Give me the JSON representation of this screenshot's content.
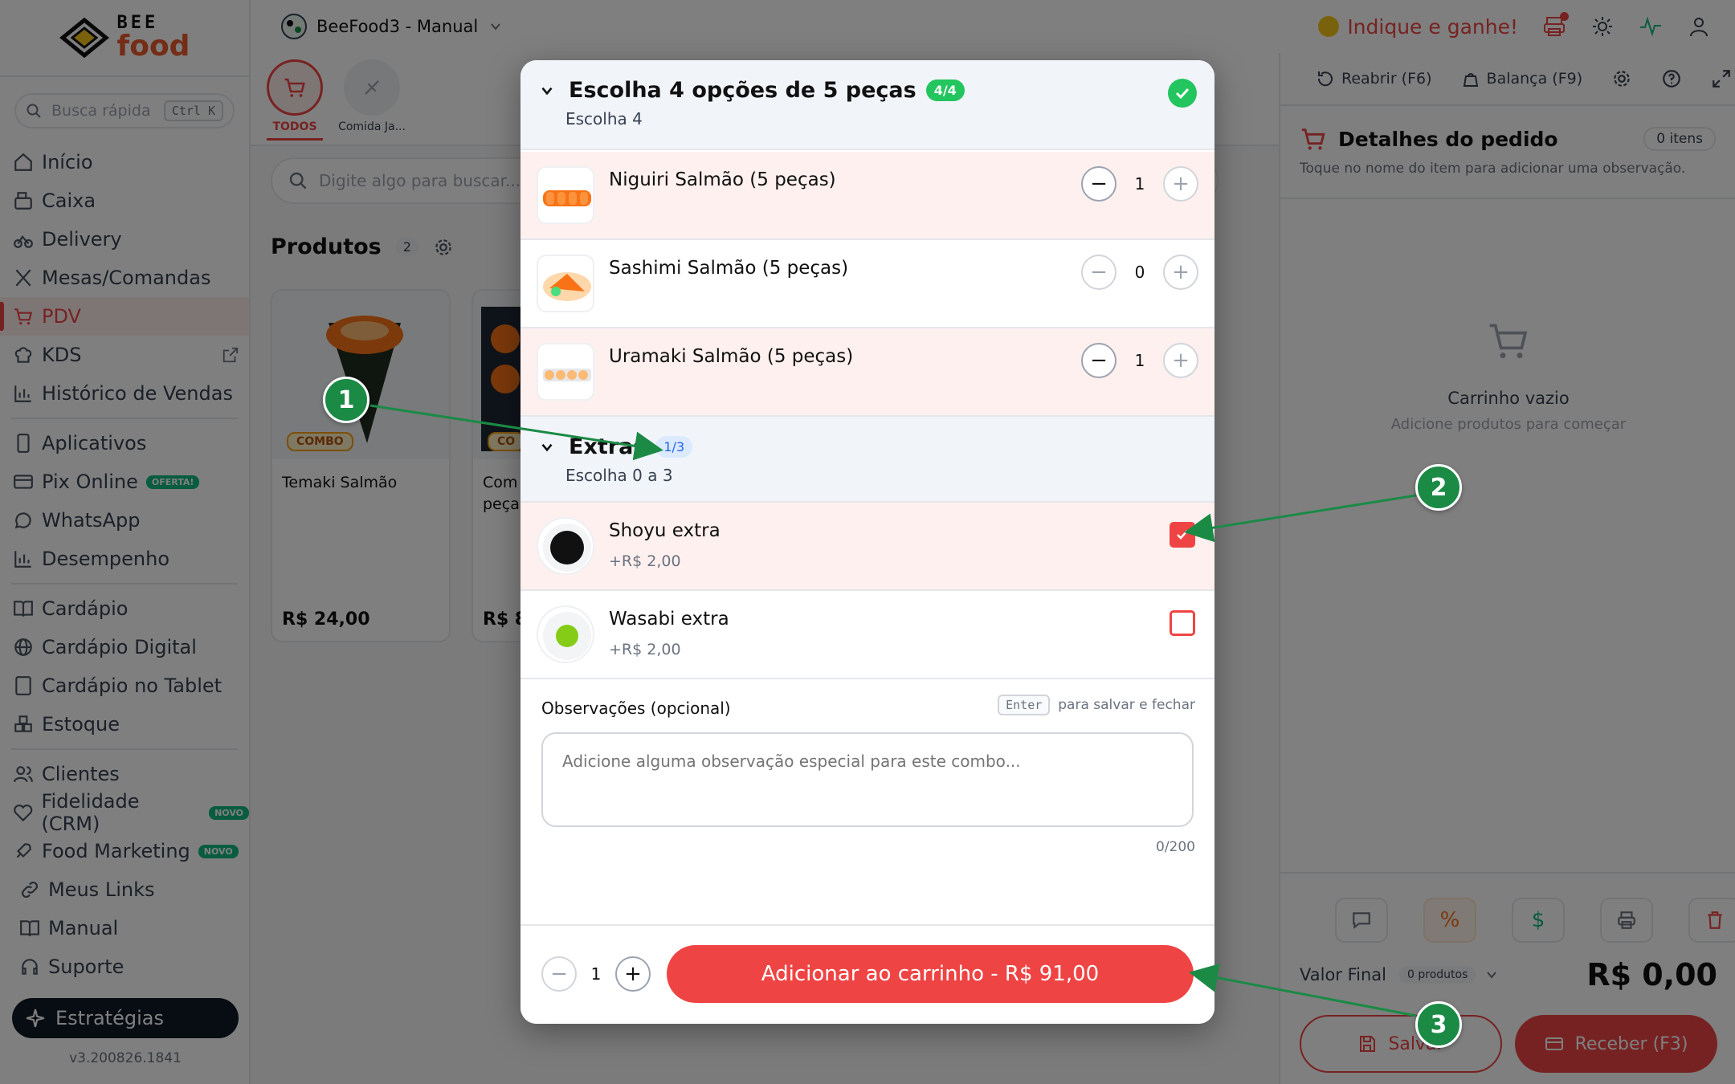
{
  "sidebar": {
    "logo": {
      "top": "BEE",
      "bottom": "food"
    },
    "quick_search": {
      "placeholder": "Busca rápida",
      "shortcut": "Ctrl K"
    },
    "items": [
      {
        "label": "Início",
        "icon": "home-icon"
      },
      {
        "label": "Caixa",
        "icon": "cash-register-icon"
      },
      {
        "label": "Delivery",
        "icon": "bike-icon"
      },
      {
        "label": "Mesas/Comandas",
        "icon": "utensils-icon"
      },
      {
        "label": "PDV",
        "icon": "cart-icon",
        "active": true
      },
      {
        "label": "KDS",
        "icon": "chef-hat-icon"
      },
      {
        "label": "Histórico de Vendas",
        "icon": "bar-chart-icon"
      },
      {
        "label": "Aplicativos",
        "icon": "smartphone-icon"
      },
      {
        "label": "Pix Online",
        "icon": "card-icon",
        "badge": "OFERTA!"
      },
      {
        "label": "WhatsApp",
        "icon": "chat-icon"
      },
      {
        "label": "Desempenho",
        "icon": "bar-chart-icon"
      },
      {
        "label": "Cardápio",
        "icon": "book-icon"
      },
      {
        "label": "Cardápio Digital",
        "icon": "globe-icon"
      },
      {
        "label": "Cardápio no Tablet",
        "icon": "tablet-icon"
      },
      {
        "label": "Estoque",
        "icon": "boxes-icon"
      },
      {
        "label": "Clientes",
        "icon": "users-icon"
      },
      {
        "label": "Fidelidade (CRM)",
        "icon": "heart-icon",
        "badge": "NOVO"
      },
      {
        "label": "Food Marketing",
        "icon": "rocket-icon",
        "badge": "NOVO"
      },
      {
        "label": "Meus Links",
        "icon": "link-icon"
      },
      {
        "label": "Manual",
        "icon": "book-icon"
      },
      {
        "label": "Suporte",
        "icon": "headset-icon"
      }
    ],
    "strategies_label": "Estratégias",
    "version": "v3.200826.1841"
  },
  "topbar": {
    "store_name": "BeeFood3 - Manual",
    "referral": "Indique e ganhe!"
  },
  "pdv": {
    "categories": [
      {
        "label": "TODOS",
        "active": true
      },
      {
        "label": "Comida Ja..."
      }
    ],
    "search_placeholder": "Digite algo para buscar...",
    "products_title": "Produtos",
    "products_count": "2",
    "products": [
      {
        "name": "Temaki Salmão",
        "price": "R$ 24,00",
        "tag": "COMBO"
      },
      {
        "name": "Com\npeça",
        "price": "R$ 8",
        "tag": "CO"
      }
    ]
  },
  "cart": {
    "tools": {
      "reopen": "Reabrir (F6)",
      "scale": "Balança (F9)"
    },
    "title": "Detalhes do pedido",
    "items_count": "0 itens",
    "subtitle": "Toque no nome do item para adicionar uma observação.",
    "empty_title": "Carrinho vazio",
    "empty_sub": "Adicione produtos para começar",
    "final_label": "Valor Final",
    "products_pill": "0 produtos",
    "total": "R$ 0,00",
    "save_label": "Salvar",
    "receive_label": "Receber (F3)"
  },
  "modal": {
    "group1": {
      "title": "Escolha 4 opções de 5 peças",
      "badge": "4/4",
      "subtitle": "Escolha 4",
      "options": [
        {
          "name": "Niguiri Salmão (5 peças)",
          "qty": "1",
          "selected": true
        },
        {
          "name": "Sashimi Salmão (5 peças)",
          "qty": "0",
          "selected": false
        },
        {
          "name": "Uramaki Salmão (5 peças)",
          "qty": "1",
          "selected": true
        }
      ]
    },
    "group2": {
      "title": "Extras",
      "badge": "1/3",
      "subtitle": "Escolha 0 a 3",
      "options": [
        {
          "name": "Shoyu extra",
          "price": "+R$ 2,00",
          "checked": true
        },
        {
          "name": "Wasabi extra",
          "price": "+R$ 2,00",
          "checked": false
        }
      ]
    },
    "notes": {
      "label": "Observações (opcional)",
      "key": "Enter",
      "hint": "para salvar e fechar",
      "placeholder": "Adicione alguma observação especial para este combo...",
      "counter": "0/200"
    },
    "quantity": "1",
    "add_button": "Adicionar ao carrinho - R$ 91,00"
  },
  "annotations": [
    "1",
    "2",
    "3"
  ],
  "colors": {
    "accent": "#ef4444",
    "success": "#22c55e",
    "annotation": "#1a8a45"
  }
}
